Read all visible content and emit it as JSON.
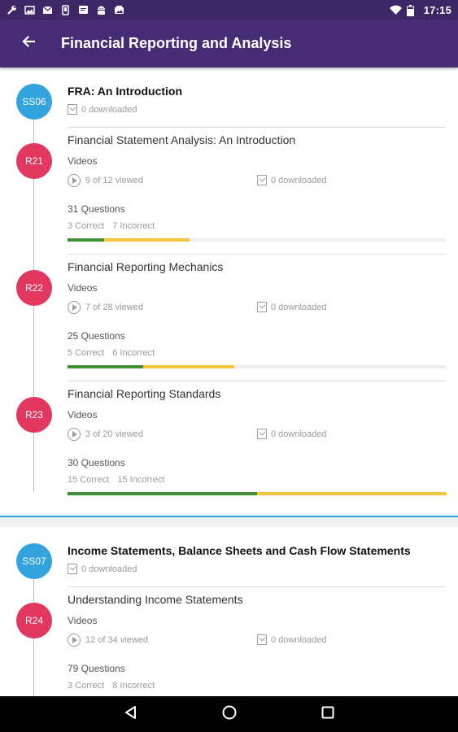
{
  "status_bar": {
    "time": "17:15",
    "left_icons": [
      "wrench-icon",
      "image-icon",
      "mail-icon",
      "phone-icon",
      "message-icon",
      "android-icon",
      "photo-icon"
    ],
    "right_icons": [
      "wifi-icon",
      "battery-icon"
    ]
  },
  "app_bar": {
    "title": "Financial Reporting and Analysis",
    "back_icon": "arrow-left-icon"
  },
  "colors": {
    "app_bar": "#452c74",
    "status_bar": "#3d2766",
    "session_node": "#32a3dc",
    "reading_node": "#e2375f",
    "correct": "#3f8f35",
    "incorrect": "#f4c53a",
    "section_divider": "#2ea0dc"
  },
  "sections": [
    {
      "code": "SS06",
      "title": "FRA: An Introduction",
      "downloaded": "0 downloaded",
      "readings": [
        {
          "code": "R21",
          "title": "Financial Statement Analysis: An Introduction",
          "videos_label": "Videos",
          "viewed": "9 of 12 viewed",
          "downloaded": "0 downloaded",
          "questions": "31 Questions",
          "correct_label": "3 Correct",
          "incorrect_label": "7 Incorrect",
          "correct": 3,
          "incorrect": 7,
          "total": 31
        },
        {
          "code": "R22",
          "title": "Financial Reporting Mechanics",
          "videos_label": "Videos",
          "viewed": "7 of 28 viewed",
          "downloaded": "0 downloaded",
          "questions": "25 Questions",
          "correct_label": "5 Correct",
          "incorrect_label": "6 Incorrect",
          "correct": 5,
          "incorrect": 6,
          "total": 25
        },
        {
          "code": "R23",
          "title": "Financial Reporting Standards",
          "videos_label": "Videos",
          "viewed": "3 of 20 viewed",
          "downloaded": "0 downloaded",
          "questions": "30 Questions",
          "correct_label": "15 Correct",
          "incorrect_label": "15 Incorrect",
          "correct": 15,
          "incorrect": 15,
          "total": 30
        }
      ]
    },
    {
      "code": "SS07",
      "title": "Income Statements, Balance Sheets and Cash Flow Statements",
      "downloaded": "0 downloaded",
      "readings": [
        {
          "code": "R24",
          "title": "Understanding Income Statements",
          "videos_label": "Videos",
          "viewed": "12 of 34 viewed",
          "downloaded": "0 downloaded",
          "questions": "79 Questions",
          "correct_label": "3 Correct",
          "incorrect_label": "8 Incorrect",
          "correct": 3,
          "incorrect": 8,
          "total": 79
        }
      ]
    }
  ],
  "nav_bar": {
    "icons": [
      "back-triangle-icon",
      "home-circle-icon",
      "recents-square-icon"
    ]
  }
}
